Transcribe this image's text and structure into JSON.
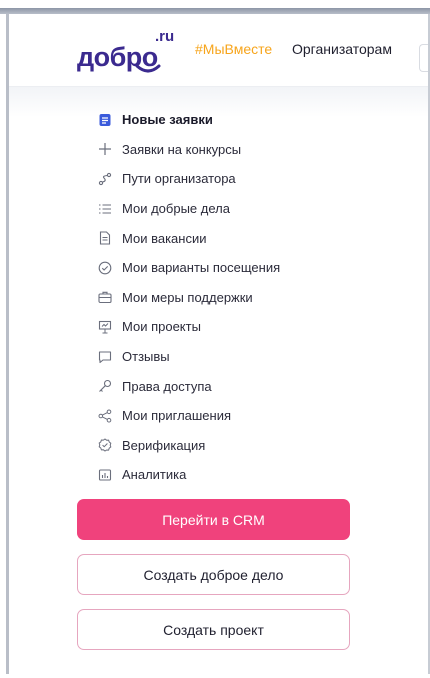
{
  "header": {
    "logo_text": "добро",
    "logo_ru": ".ru",
    "hashtag": "#МыВместе",
    "organizers_link": "Организаторам"
  },
  "menu": {
    "items": [
      {
        "label": "Новые заявки",
        "icon": "document-list-icon",
        "active": true
      },
      {
        "label": "Заявки на конкурсы",
        "icon": "plus-icon",
        "active": false
      },
      {
        "label": "Пути организатора",
        "icon": "route-icon",
        "active": false
      },
      {
        "label": "Мои добрые дела",
        "icon": "list-icon",
        "active": false
      },
      {
        "label": "Мои вакансии",
        "icon": "document-icon",
        "active": false
      },
      {
        "label": "Мои варианты посещения",
        "icon": "check-circle-icon",
        "active": false
      },
      {
        "label": "Мои меры поддержки",
        "icon": "briefcase-icon",
        "active": false
      },
      {
        "label": "Мои проекты",
        "icon": "presentation-icon",
        "active": false
      },
      {
        "label": "Отзывы",
        "icon": "chat-icon",
        "active": false
      },
      {
        "label": "Права доступа",
        "icon": "key-icon",
        "active": false
      },
      {
        "label": "Мои приглашения",
        "icon": "share-icon",
        "active": false
      },
      {
        "label": "Верификация",
        "icon": "verified-badge-icon",
        "active": false
      },
      {
        "label": "Аналитика",
        "icon": "chart-icon",
        "active": false
      }
    ]
  },
  "buttons": {
    "crm": "Перейти в CRM",
    "create_deed": "Создать доброе дело",
    "create_project": "Создать проект"
  },
  "colors": {
    "brand_purple": "#3b2a8f",
    "accent_pink": "#f0427c",
    "hashtag_orange": "#f7a51c",
    "active_icon_blue": "#3b5bdb"
  }
}
